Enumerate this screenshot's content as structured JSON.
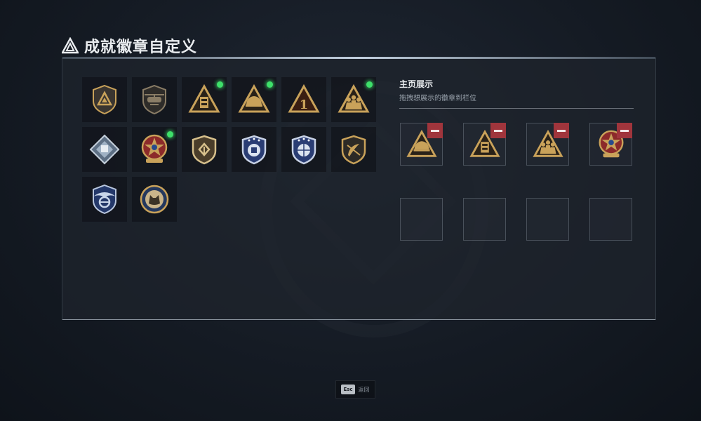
{
  "header": {
    "title": "成就徽章自定义",
    "logo": "triangle-a-logo"
  },
  "badges": [
    {
      "name": "shield-triangle-badge",
      "icon": "shield-tri",
      "new": false
    },
    {
      "name": "helicopter-shield-badge",
      "icon": "shield-heli",
      "new": false
    },
    {
      "name": "gold-triangle-tower-badge",
      "icon": "tri-tower",
      "new": true
    },
    {
      "name": "gold-triangle-helmet-badge",
      "icon": "tri-helmet",
      "new": true
    },
    {
      "name": "gold-triangle-number-badge",
      "icon": "tri-one",
      "new": false
    },
    {
      "name": "gold-triangle-squad-badge",
      "icon": "tri-squad",
      "new": true
    },
    {
      "name": "silver-diamond-badge",
      "icon": "diamond-silver",
      "new": false
    },
    {
      "name": "star-medal-badge",
      "icon": "star-medal",
      "new": true
    },
    {
      "name": "gold-shield-badge",
      "icon": "shield-gold",
      "new": false
    },
    {
      "name": "blue-shield-badge",
      "icon": "shield-blue",
      "new": false
    },
    {
      "name": "blue-shield-globe-badge",
      "icon": "shield-blue-globe",
      "new": false
    },
    {
      "name": "dark-shield-emblem-badge",
      "icon": "shield-dark",
      "new": false
    },
    {
      "name": "blue-wing-badge",
      "icon": "wing-blue",
      "new": false
    },
    {
      "name": "round-wolf-badge",
      "icon": "round-wolf",
      "new": false
    }
  ],
  "showcase": {
    "title": "主页展示",
    "subtitle": "拖拽想展示的徽章到栏位",
    "slots": [
      {
        "icon": "tri-helmet"
      },
      {
        "icon": "tri-tower"
      },
      {
        "icon": "tri-squad"
      },
      {
        "icon": "star-medal"
      },
      {
        "icon": ""
      },
      {
        "icon": ""
      },
      {
        "icon": ""
      },
      {
        "icon": ""
      }
    ]
  },
  "footer": {
    "key": "Esc",
    "label": "返回"
  },
  "colors": {
    "gold": "#c9a25a",
    "remove": "#a0353c",
    "new_dot": "#3ee06a"
  }
}
